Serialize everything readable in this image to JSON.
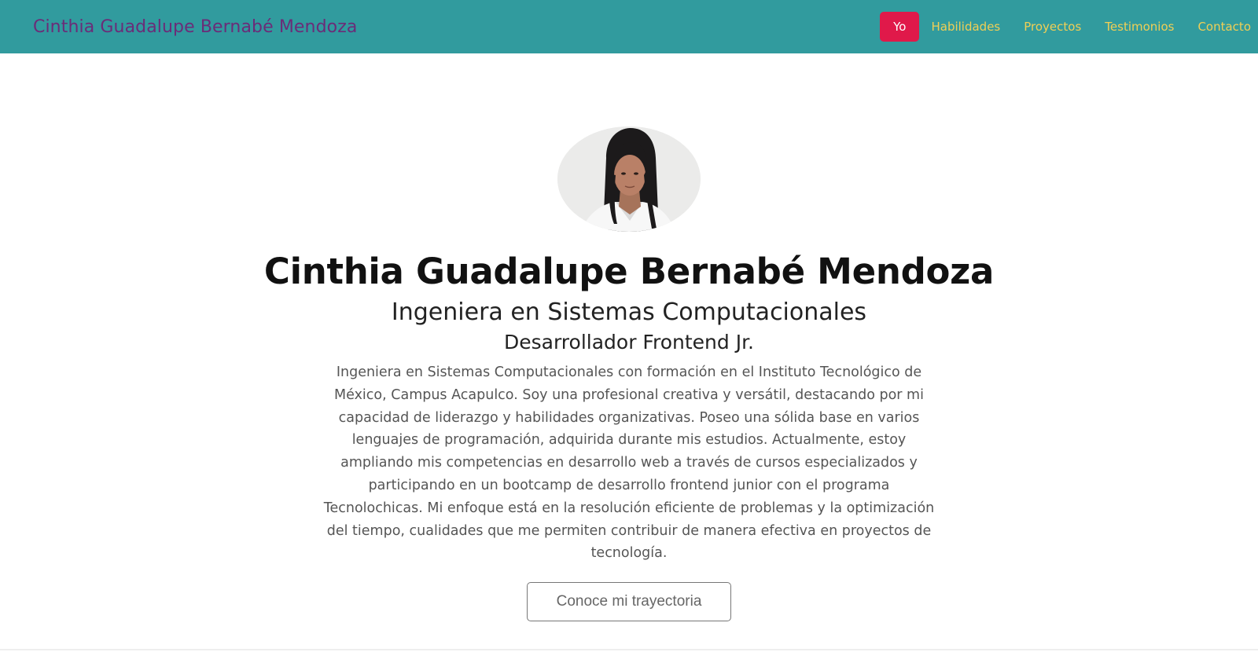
{
  "navbar": {
    "brand": "Cinthia Guadalupe Bernabé Mendoza",
    "items": [
      {
        "label": "Yo",
        "active": true
      },
      {
        "label": "Habilidades"
      },
      {
        "label": "Proyectos"
      },
      {
        "label": "Testimonios"
      },
      {
        "label": "Contacto"
      }
    ]
  },
  "hero": {
    "name": "Cinthia Guadalupe Bernabé Mendoza",
    "role": "Ingeniera en Sistemas Computacionales",
    "position": "Desarrollador Frontend Jr.",
    "bio": "Ingeniera en Sistemas Computacionales con formación en el Instituto Tecnológico de México, Campus Acapulco. Soy una profesional creativa y versátil, destacando por mi capacidad de liderazgo y habilidades organizativas. Poseo una sólida base en varios lenguajes de programación, adquirida durante mis estudios. Actualmente, estoy ampliando mis competencias en desarrollo web a través de cursos especializados y participando en un bootcamp de desarrollo frontend junior con el programa Tecnolochicas. Mi enfoque está en la resolución eficiente de problemas y la optimización del tiempo, cualidades que me permiten contribuir de manera efectiva en proyectos de tecnología.",
    "cta_label": "Conoce mi trayectoria"
  },
  "colors": {
    "navbar_bg": "#319b9e",
    "brand": "#6b2c78",
    "nav_link": "#f0cf55",
    "nav_active_bg": "#e0194a"
  }
}
